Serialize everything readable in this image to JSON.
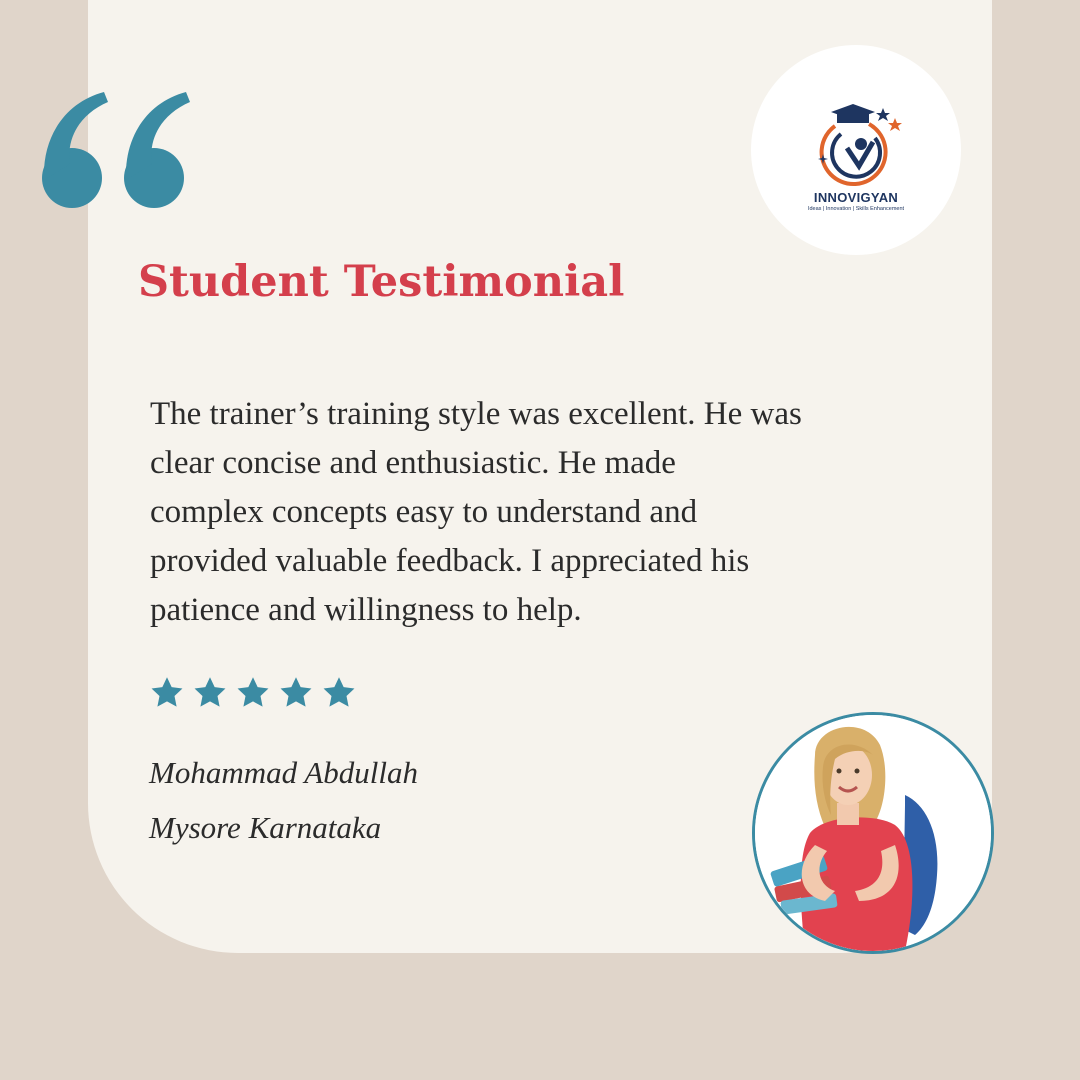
{
  "brand": {
    "name": "INNOVIGYAN",
    "tagline": "Ideas | Innovation | Skills Enhancement"
  },
  "title": "Student Testimonial",
  "testimonial": {
    "lines": [
      "The trainer’s training style was excellent. He was",
      "clear concise and enthusiastic. He made",
      "complex concepts easy to understand and",
      "provided valuable feedback. I appreciated his",
      "patience and willingness to help."
    ]
  },
  "rating": {
    "value": 5,
    "max": 5
  },
  "author": {
    "name": "Mohammad Abdullah",
    "location": "Mysore Karnataka"
  },
  "colors": {
    "background": "#e0d5ca",
    "card": "#f6f3ed",
    "accent_teal": "#3b8ba3",
    "title_red": "#d43f4c",
    "text": "#2b2b2b"
  },
  "icons": {
    "quote": "quote-icon",
    "star": "star-icon",
    "logo": "graduation-cap-logo"
  }
}
